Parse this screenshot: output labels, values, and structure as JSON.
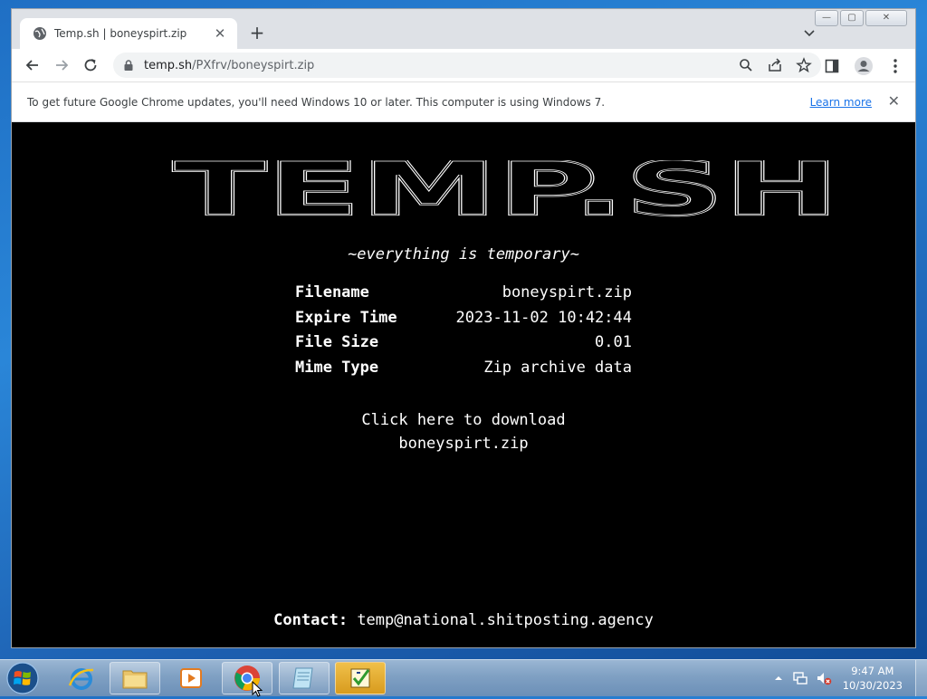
{
  "browser": {
    "tab_title": "Temp.sh | boneyspirt.zip",
    "tab_close": "✕",
    "new_tab": "+",
    "url_host": "temp.sh",
    "url_path": "/PXfrv/boneyspirt.zip",
    "window_controls": {
      "minimize": "—",
      "maximize": "▢",
      "close": "✕"
    }
  },
  "infobar": {
    "message": "To get future Google Chrome updates, you'll need Windows 10 or later. This computer is using Windows 7.",
    "learn_more": "Learn more",
    "close": "✕"
  },
  "page": {
    "logo_text": "TEMP.SH",
    "tagline": "~everything is temporary~",
    "fields": [
      {
        "key": "Filename",
        "value": "boneyspirt.zip"
      },
      {
        "key": "Expire Time",
        "value": "2023-11-02 10:42:44"
      },
      {
        "key": "File Size",
        "value": "0.01"
      },
      {
        "key": "Mime Type",
        "value": "Zip archive data"
      }
    ],
    "download_line1": "Click here to download",
    "download_line2": "boneyspirt.zip",
    "contact_label": "Contact:",
    "contact_email": "temp@national.shitposting.agency"
  },
  "taskbar": {
    "time": "9:47 AM",
    "date": "10/30/2023",
    "icons": [
      "windows-start-icon",
      "internet-explorer-icon",
      "file-explorer-icon",
      "media-player-icon",
      "chrome-icon",
      "notepad-icon",
      "tasks-icon"
    ]
  }
}
